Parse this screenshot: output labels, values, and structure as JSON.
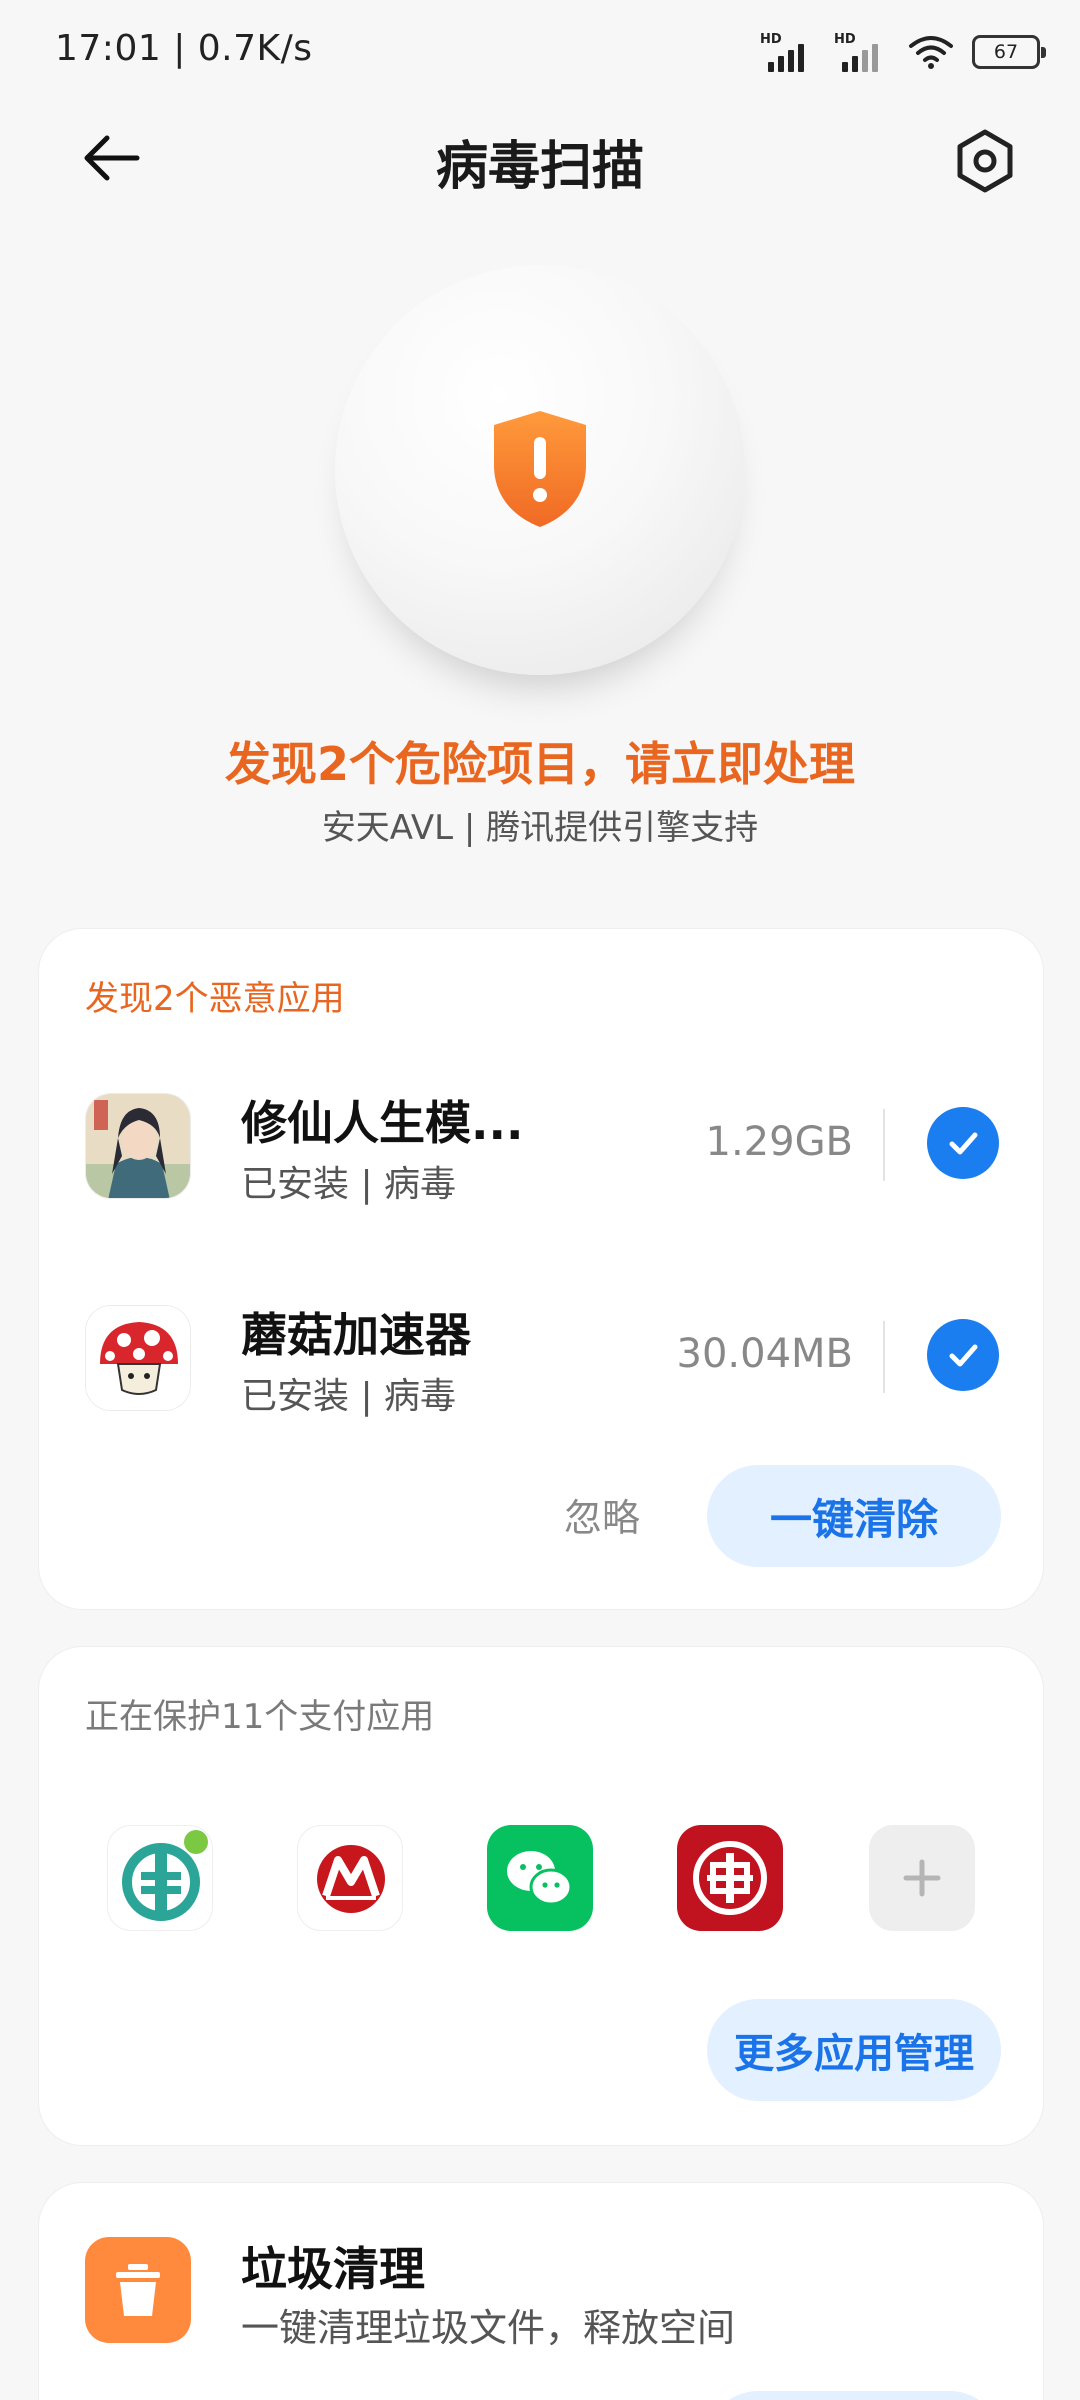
{
  "status_bar": {
    "time_speed": "17:01 | 0.7K/s",
    "sim1_label": "HD",
    "sim2_label": "HD",
    "battery": "67"
  },
  "nav": {
    "title": "病毒扫描"
  },
  "hero": {
    "headline": "发现2个危险项目，请立即处理",
    "engine": "安天AVL | 腾讯提供引擎支持",
    "accent_color": "#e8661f"
  },
  "malware_card": {
    "title": "发现2个恶意应用",
    "apps": [
      {
        "name": "修仙人生模...",
        "status": "已安装 | 病毒",
        "size": "1.29GB",
        "checked": true
      },
      {
        "name": "蘑菇加速器",
        "status": "已安装 | 病毒",
        "size": "30.04MB",
        "checked": true
      }
    ],
    "ignore_label": "忽略",
    "clean_label": "一键清除"
  },
  "payment_card": {
    "title": "正在保护11个支付应用",
    "apps": [
      "abc-bank-icon",
      "cmb-bank-icon",
      "wechat-icon",
      "icbc-bank-icon",
      "add-icon"
    ],
    "more_label": "更多应用管理"
  },
  "junk_card": {
    "title": "垃圾清理",
    "subtitle": "一键清理垃圾文件，释放空间"
  },
  "colors": {
    "primary_blue": "#1a7df0",
    "button_bg": "#e3f0ff",
    "warning_orange": "#e8661f"
  }
}
